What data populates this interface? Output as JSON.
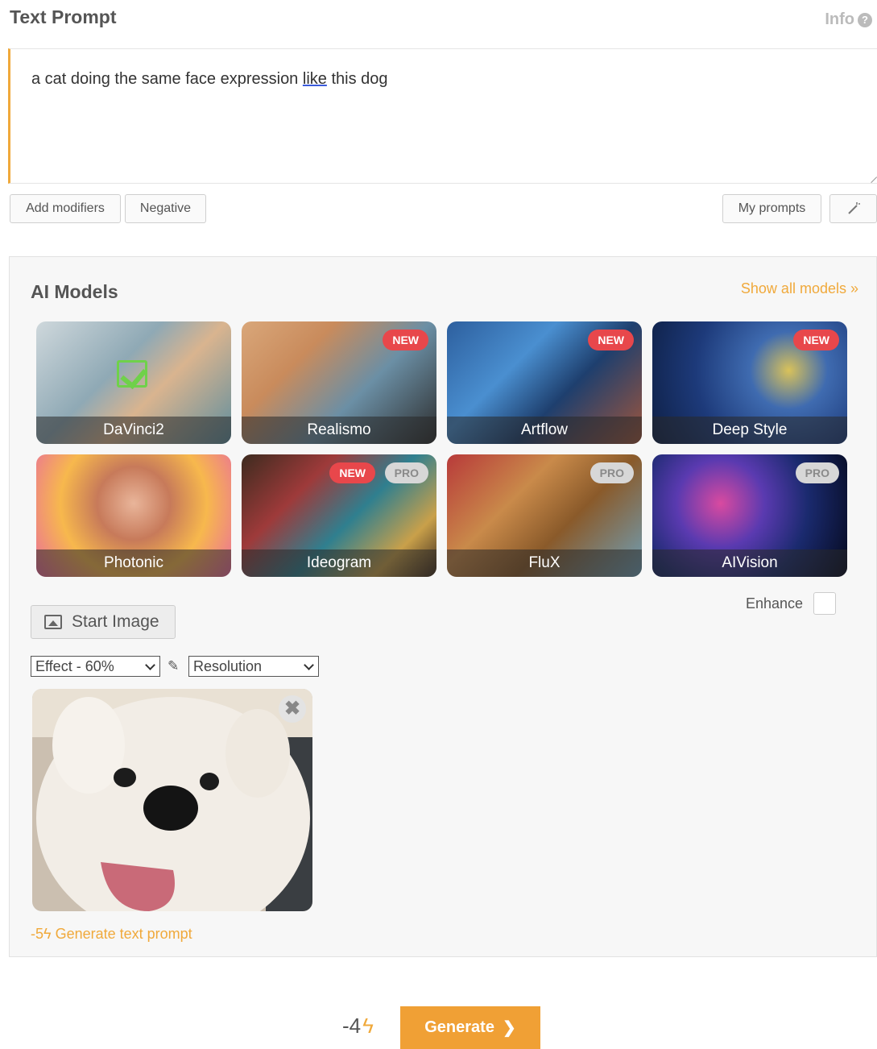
{
  "header": {
    "title": "Text Prompt",
    "info_label": "Info",
    "info_icon_glyph": "?"
  },
  "prompt": {
    "text_before": "a cat doing the same face expression ",
    "text_underlined": "like",
    "text_after": " this dog"
  },
  "toolbar": {
    "add_modifiers": "Add modifiers",
    "negative": "Negative",
    "my_prompts": "My prompts",
    "magic_icon": "magic-wand-icon"
  },
  "models": {
    "title": "AI Models",
    "show_all": "Show all models",
    "items": [
      {
        "name": "DaVinci2",
        "selected": true,
        "badges": []
      },
      {
        "name": "Realismo",
        "badges": [
          "NEW"
        ]
      },
      {
        "name": "Artflow",
        "badges": [
          "NEW"
        ]
      },
      {
        "name": "Deep Style",
        "badges": [
          "NEW"
        ]
      },
      {
        "name": "Photonic",
        "badges": []
      },
      {
        "name": "Ideogram",
        "badges": [
          "NEW",
          "PRO"
        ]
      },
      {
        "name": "FluX",
        "badges": [
          "PRO"
        ]
      },
      {
        "name": "AIVision",
        "badges": [
          "PRO"
        ]
      }
    ]
  },
  "start_image": {
    "label": "Start Image"
  },
  "enhance": {
    "label": "Enhance",
    "checked": false
  },
  "effect_select": {
    "value": "Effect - 60%"
  },
  "resolution_select": {
    "value": "Resolution"
  },
  "generate_text": {
    "cost": "-5",
    "label": "Generate text prompt"
  },
  "footer": {
    "cost": "-4",
    "generate_label": "Generate"
  },
  "colors": {
    "accent": "#f0a93b",
    "new_badge": "#e8474b",
    "pro_badge": "#d7d7d7"
  }
}
